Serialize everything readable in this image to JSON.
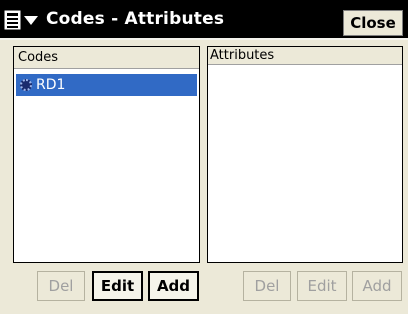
{
  "window": {
    "title": "Codes - Attributes",
    "close_label": "Close"
  },
  "codes_pane": {
    "header": "Codes",
    "items": [
      {
        "label": "RD1",
        "selected": true
      }
    ],
    "buttons": {
      "del": "Del",
      "edit": "Edit",
      "add": "Add"
    }
  },
  "attributes_pane": {
    "header": "Attributes",
    "items": [],
    "buttons": {
      "del": "Del",
      "edit": "Edit",
      "add": "Add"
    }
  },
  "colors": {
    "titlebar": "#000000",
    "selection": "#316ac5",
    "window_bg": "#ece9d8",
    "disabled_text": "#a0a0a0"
  },
  "icons": {
    "menu": "start-menu-icon",
    "menu_caret": "caret-down-icon",
    "item_marker": "code-point-icon"
  }
}
